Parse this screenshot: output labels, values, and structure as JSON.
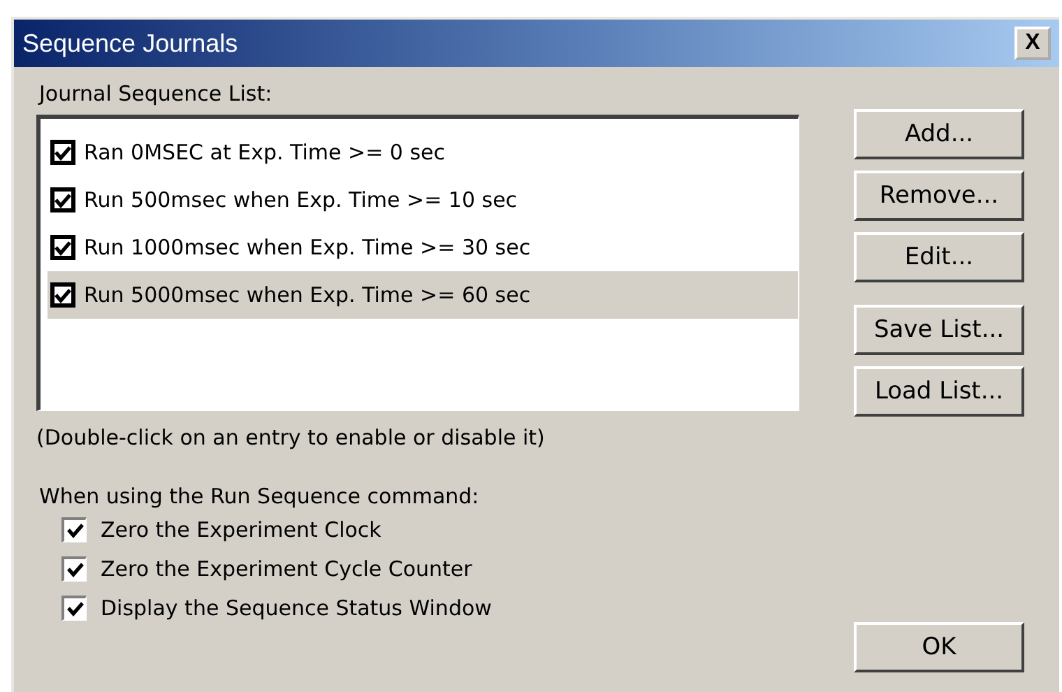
{
  "window": {
    "title": "Sequence Journals",
    "close": "X"
  },
  "journal_list": {
    "label": "Journal Sequence List:",
    "entries": [
      {
        "text": "Ran 0MSEC at Exp. Time >= 0 sec",
        "checked": true,
        "selected": false
      },
      {
        "text": "Run 500msec when Exp. Time >= 10 sec",
        "checked": true,
        "selected": false
      },
      {
        "text": "Run 1000msec when Exp. Time >= 30 sec",
        "checked": true,
        "selected": false
      },
      {
        "text": "Run 5000msec when Exp. Time >= 60 sec",
        "checked": true,
        "selected": true
      }
    ]
  },
  "entry_buttons": [
    "Add...",
    "Remove...",
    "Edit..."
  ],
  "file_buttons": [
    "Save List...",
    "Load List..."
  ],
  "hint": "(Double-click on an entry to enable or disable it)",
  "options": {
    "label": "When using the Run Sequence command:",
    "items": [
      {
        "label": "Zero the Experiment Clock",
        "checked": true
      },
      {
        "label": "Zero the Experiment Cycle Counter",
        "checked": true
      },
      {
        "label": "Display the Sequence Status Window",
        "checked": true
      }
    ]
  },
  "ok_button": "OK"
}
